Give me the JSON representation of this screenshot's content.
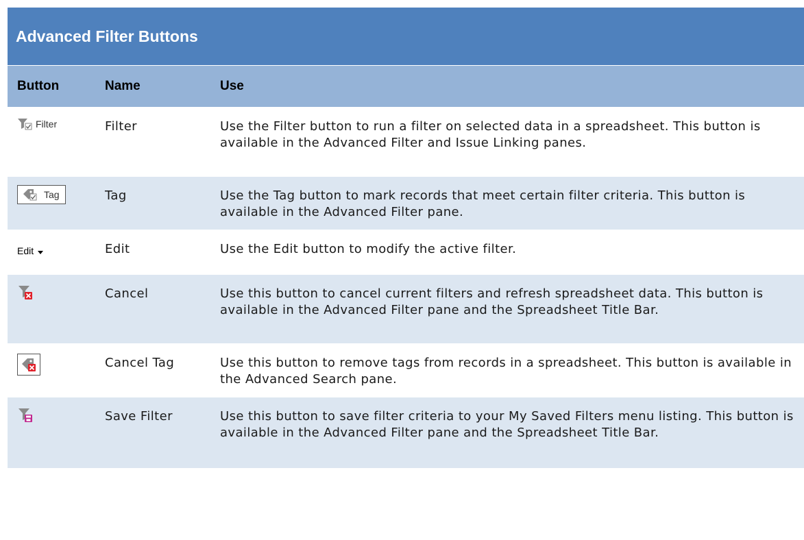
{
  "title": "Advanced Filter Buttons",
  "headers": {
    "button": "Button",
    "name": "Name",
    "use": "Use"
  },
  "rows": [
    {
      "button_label": "Filter",
      "icon": "filter-check-icon",
      "name": "Filter",
      "use": "Use the Filter button to run a filter on selected data in a spreadsheet. This button is available in the Advanced Filter and Issue Linking panes."
    },
    {
      "button_label": "Tag",
      "icon": "tag-check-icon",
      "name": "Tag",
      "use": "Use the Tag button to mark records that meet certain filter criteria. This button is available in the Advanced Filter pane."
    },
    {
      "button_label": "Edit",
      "icon": "chevron-down-icon",
      "name": "Edit",
      "use": "Use the Edit button to modify the active filter."
    },
    {
      "button_label": "",
      "icon": "filter-cancel-icon",
      "name": "Cancel",
      "use": "Use this button to cancel current filters and refresh spreadsheet data. This button is available in the Advanced Filter pane and the Spreadsheet Title Bar."
    },
    {
      "button_label": "",
      "icon": "tag-cancel-icon",
      "name": "Cancel Tag",
      "use": "Use this button to remove tags from records in a spreadsheet. This button is available in the Advanced Search pane."
    },
    {
      "button_label": "",
      "icon": "filter-save-icon",
      "name": "Save Filter",
      "use": "Use this button to save filter criteria to your My Saved Filters menu listing. This button is available in the Advanced Filter pane and the Spreadsheet Title Bar."
    }
  ]
}
